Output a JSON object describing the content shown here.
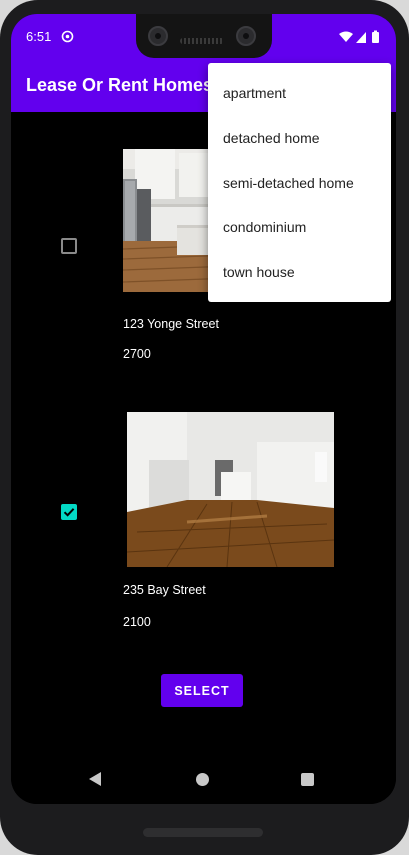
{
  "status_bar": {
    "time": "6:51",
    "icons": [
      "sync-icon",
      "wifi-icon",
      "battery-icon"
    ]
  },
  "app_bar": {
    "title": "Lease Or Rent Homes"
  },
  "listings": [
    {
      "address": "123 Yonge Street",
      "price": "2700",
      "checked": false,
      "image": "kitchen-photo"
    },
    {
      "address": "235 Bay Street",
      "price": "2100",
      "checked": true,
      "image": "living-room-photo"
    }
  ],
  "select_button": {
    "label": "SELECT"
  },
  "dropdown": {
    "options": [
      "apartment",
      "detached home",
      "semi-detached home",
      "condominium",
      "town house"
    ]
  },
  "colors": {
    "primary": "#6200ee",
    "accent": "#03dac5",
    "background": "#000000"
  },
  "nav_bar": {
    "icons": [
      "back-icon",
      "home-icon",
      "recents-icon"
    ]
  }
}
